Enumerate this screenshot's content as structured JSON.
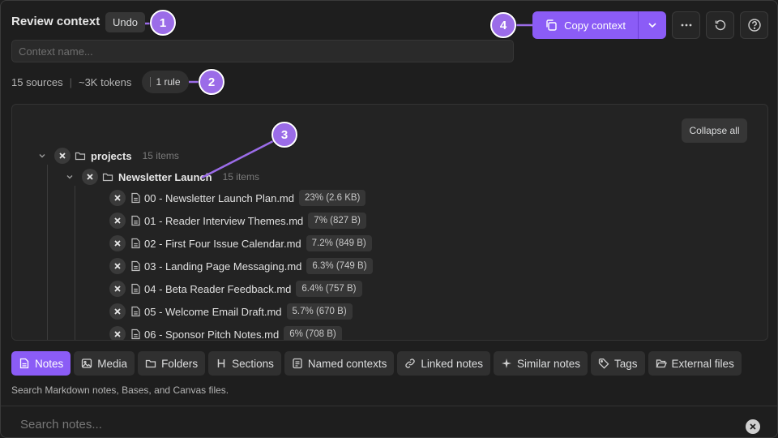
{
  "header": {
    "title": "Review context",
    "undo_label": "Undo",
    "name_placeholder": "Context name...",
    "copy_label": "Copy context"
  },
  "stats": {
    "sources": "15 sources",
    "separator": "|",
    "tokens": "~3K tokens",
    "rule_label": "1 rule"
  },
  "badges": [
    "1",
    "2",
    "3",
    "4"
  ],
  "tree": {
    "collapse_label": "Collapse all",
    "root": {
      "name": "projects",
      "count": "15 items"
    },
    "sub": {
      "name": "Newsletter Launch",
      "count": "15 items"
    },
    "files": [
      {
        "name": "00 - Newsletter Launch Plan.md",
        "size": "23% (2.6 KB)"
      },
      {
        "name": "01 - Reader Interview Themes.md",
        "size": "7% (827 B)"
      },
      {
        "name": "02 - First Four Issue Calendar.md",
        "size": "7.2% (849 B)"
      },
      {
        "name": "03 - Landing Page Messaging.md",
        "size": "6.3% (749 B)"
      },
      {
        "name": "04 - Beta Reader Feedback.md",
        "size": "6.4% (757 B)"
      },
      {
        "name": "05 - Welcome Email Draft.md",
        "size": "5.7% (670 B)"
      },
      {
        "name": "06 - Sponsor Pitch Notes.md",
        "size": "6% (708 B)"
      }
    ]
  },
  "tabs": [
    {
      "label": "Notes",
      "icon": "note-icon"
    },
    {
      "label": "Media",
      "icon": "image-icon"
    },
    {
      "label": "Folders",
      "icon": "folder-icon"
    },
    {
      "label": "Sections",
      "icon": "heading-icon"
    },
    {
      "label": "Named contexts",
      "icon": "list-icon"
    },
    {
      "label": "Linked notes",
      "icon": "link-icon"
    },
    {
      "label": "Similar notes",
      "icon": "sparkle-icon"
    },
    {
      "label": "Tags",
      "icon": "tag-icon"
    },
    {
      "label": "External files",
      "icon": "folder-open-icon"
    }
  ],
  "hint": "Search Markdown notes, Bases, and Canvas files.",
  "search": {
    "placeholder": "Search notes..."
  },
  "colors": {
    "accent": "#8b5cf6",
    "badge": "#9b6ce8",
    "background": "#1e1e1e"
  }
}
